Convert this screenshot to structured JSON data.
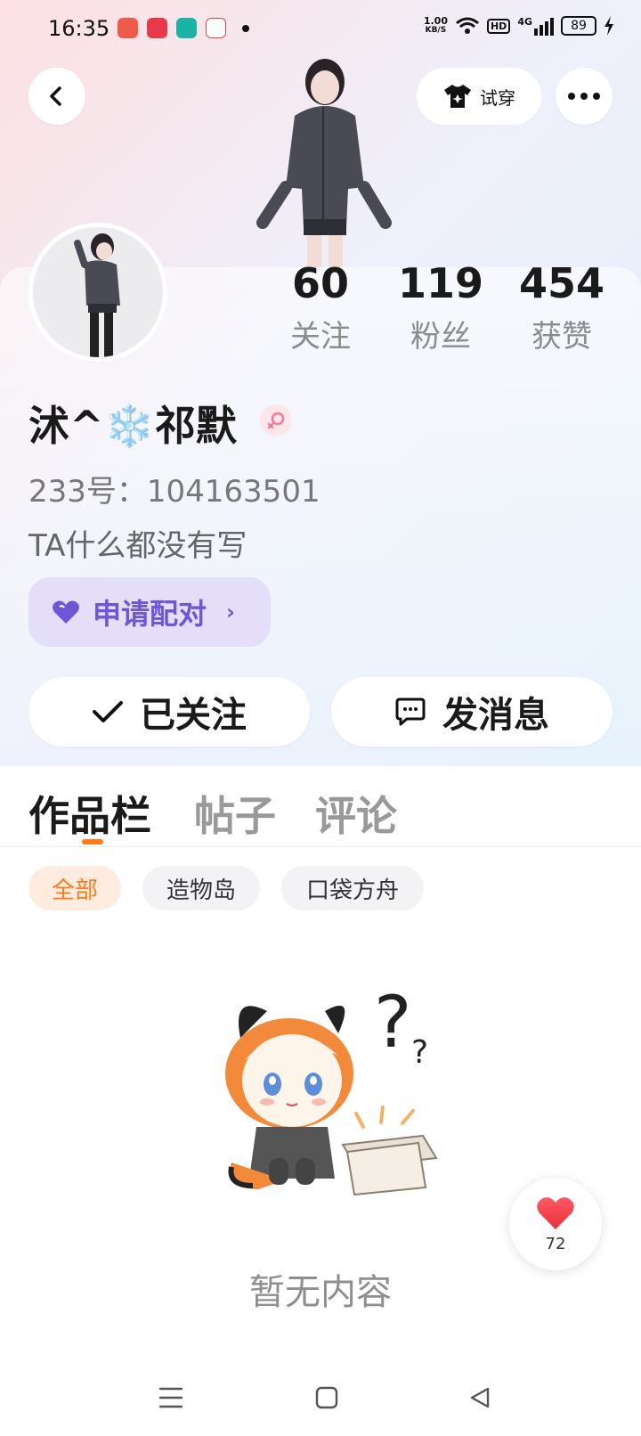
{
  "status_bar": {
    "time": "16:35",
    "net_speed_value": "1.00",
    "net_speed_unit": "KB/S",
    "hd": "HD",
    "net_type": "4G",
    "battery": "89",
    "app_icon_colors": [
      "#ee5b4a",
      "#e8394a",
      "#1bb3a4",
      "#ffffff"
    ]
  },
  "header": {
    "back_icon": "back-arrow-icon",
    "tryon_label": "试穿",
    "tryon_icon": "tshirt-icon",
    "more_icon": "more-icon"
  },
  "stats": [
    {
      "count": "60",
      "label": "关注"
    },
    {
      "count": "119",
      "label": "粉丝"
    },
    {
      "count": "454",
      "label": "获赞"
    }
  ],
  "profile": {
    "nickname": "沭^❄️祁默",
    "gender_icon": "female-icon",
    "id_line": "233号：104163501",
    "bio": "TA什么都没有写",
    "pair_label": "申请配对",
    "pair_icon": "heart-icon"
  },
  "actions": {
    "follow_label": "已关注",
    "message_label": "发消息"
  },
  "tabs": [
    {
      "label": "作品栏",
      "active": true
    },
    {
      "label": "帖子",
      "active": false
    },
    {
      "label": "评论",
      "active": false
    }
  ],
  "filters": [
    {
      "label": "全部",
      "active": true
    },
    {
      "label": "造物岛",
      "active": false
    },
    {
      "label": "口袋方舟",
      "active": false
    }
  ],
  "empty_state": {
    "text": "暂无内容"
  },
  "like_fab": {
    "count": "72",
    "icon": "heart-icon"
  },
  "colors": {
    "accent_orange": "#ff7a1a",
    "pair_purple": "#6d57d6",
    "pair_bg": "#e4def8",
    "text_primary": "#1a1a1a",
    "text_secondary": "#8c8c8c"
  }
}
